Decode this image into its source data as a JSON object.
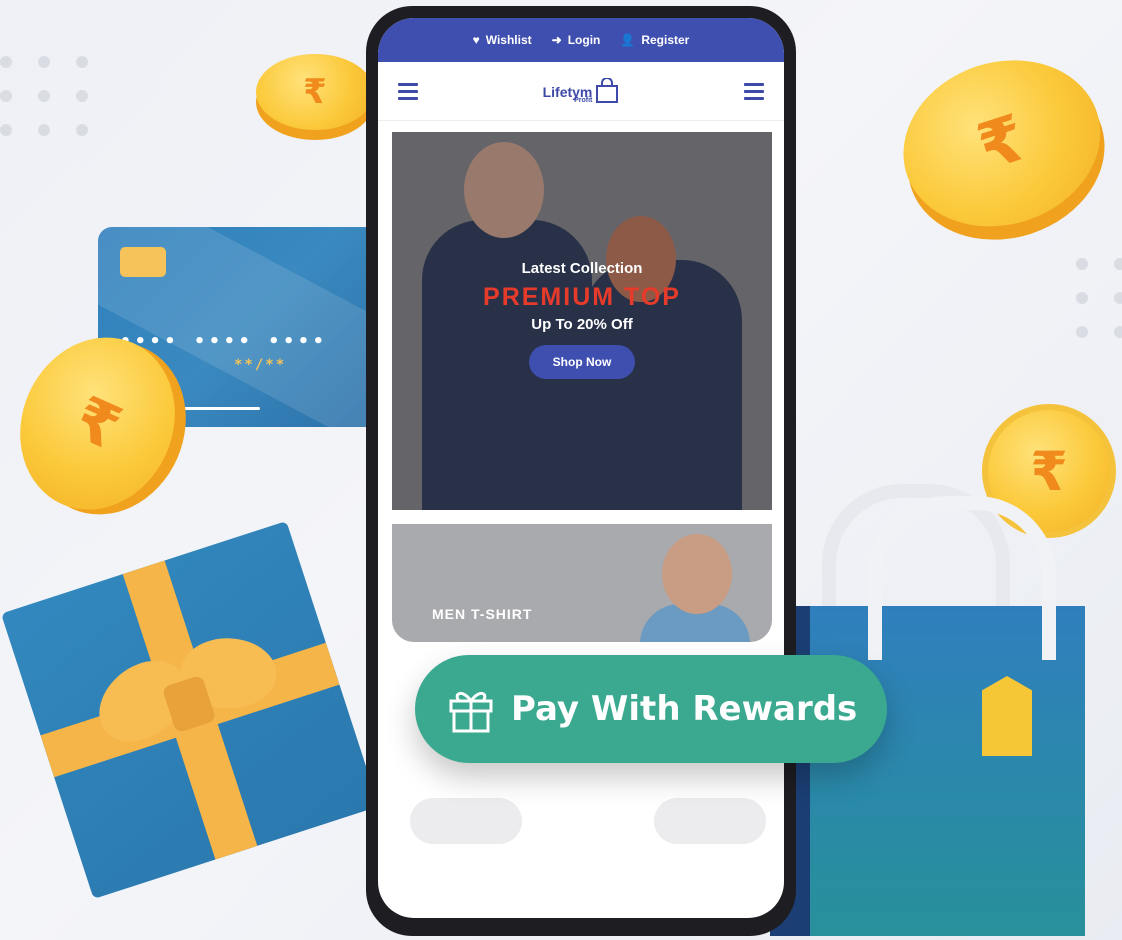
{
  "topbar": {
    "wishlist": "Wishlist",
    "login": "Login",
    "register": "Register"
  },
  "logo": {
    "name": "Lifetym",
    "sub": "Profit"
  },
  "hero": {
    "latest": "Latest Collection",
    "premium": "PREMIUM TOP",
    "offer": "Up To 20% Off",
    "cta": "Shop Now"
  },
  "banner2": {
    "label": "MEN T-SHIRT"
  },
  "card": {
    "number": "•••• •••• ••••",
    "expiry": "**/**"
  },
  "rewards": {
    "label": "Pay With Rewards"
  },
  "coin_symbol": "₹",
  "colors": {
    "brand": "#3f4fb0",
    "accent": "#e63a2a",
    "rewards": "#3aa98f",
    "coin": "#fbc93a"
  },
  "icons": [
    "heart-icon",
    "login-icon",
    "register-icon",
    "hamburger-icon",
    "bag-logo-icon",
    "gift-icon",
    "rupee-coin-icon"
  ]
}
